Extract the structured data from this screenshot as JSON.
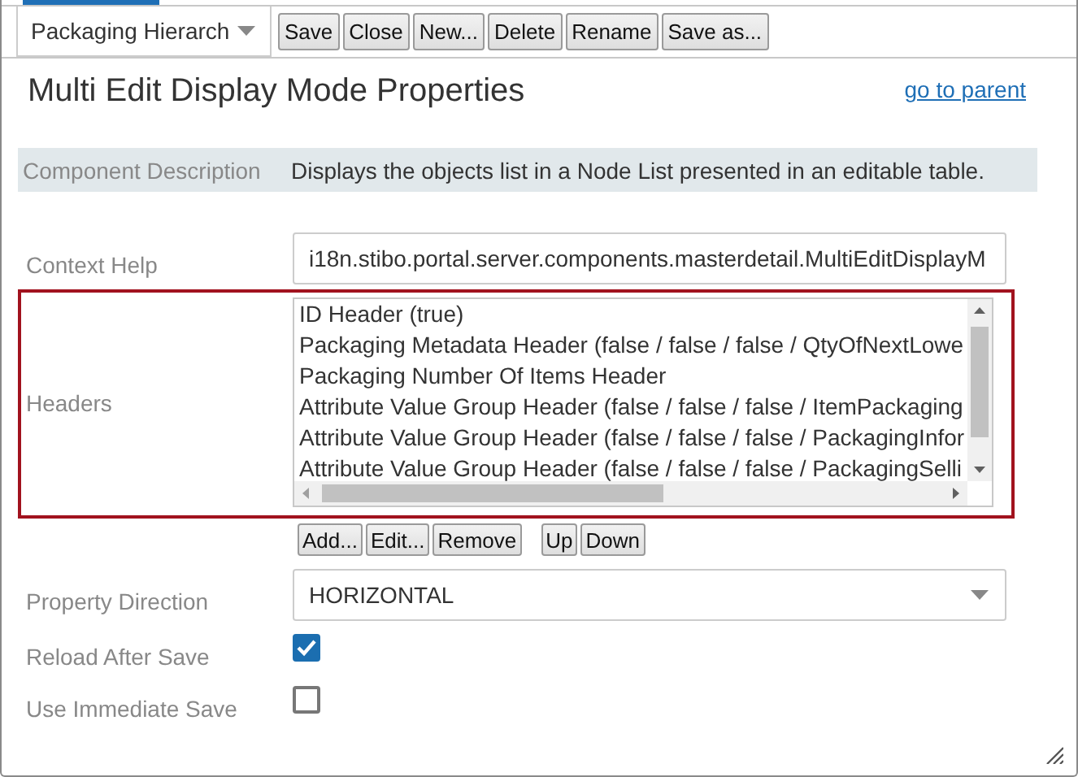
{
  "toolbar": {
    "dropdown": "Packaging Hierarch",
    "buttons": [
      "Save",
      "Close",
      "New...",
      "Delete",
      "Rename",
      "Save as..."
    ]
  },
  "title": "Multi Edit Display Mode Properties",
  "parent_link": "go to parent",
  "description": {
    "label": "Component Description",
    "text": "Displays the objects list in a Node List presented in an editable table."
  },
  "properties": [
    {
      "kind": "text",
      "label": "Context Help",
      "value": "i18n.stibo.portal.server.components.masterdetail.MultiEditDisplayM"
    },
    {
      "kind": "list",
      "label": "Headers",
      "highlighted": true,
      "items": [
        "ID Header (true)",
        "Packaging Metadata Header (false / false / false / QtyOfNextLowe",
        "Packaging Number Of Items Header",
        "Attribute Value Group Header (false / false / false / ItemPackaging",
        "Attribute Value Group Header (false / false / false / PackagingInfor",
        "Attribute Value Group Header (false / false / false / PackagingSelli"
      ],
      "edit_buttons": [
        "Add...",
        "Edit...",
        "Remove"
      ],
      "order_buttons": [
        "Up",
        "Down"
      ]
    },
    {
      "kind": "select",
      "label": "Property Direction",
      "value": "HORIZONTAL"
    },
    {
      "kind": "checkbox",
      "label": "Reload After Save",
      "checked": true
    },
    {
      "kind": "checkbox",
      "label": "Use Immediate Save",
      "checked": false
    }
  ]
}
